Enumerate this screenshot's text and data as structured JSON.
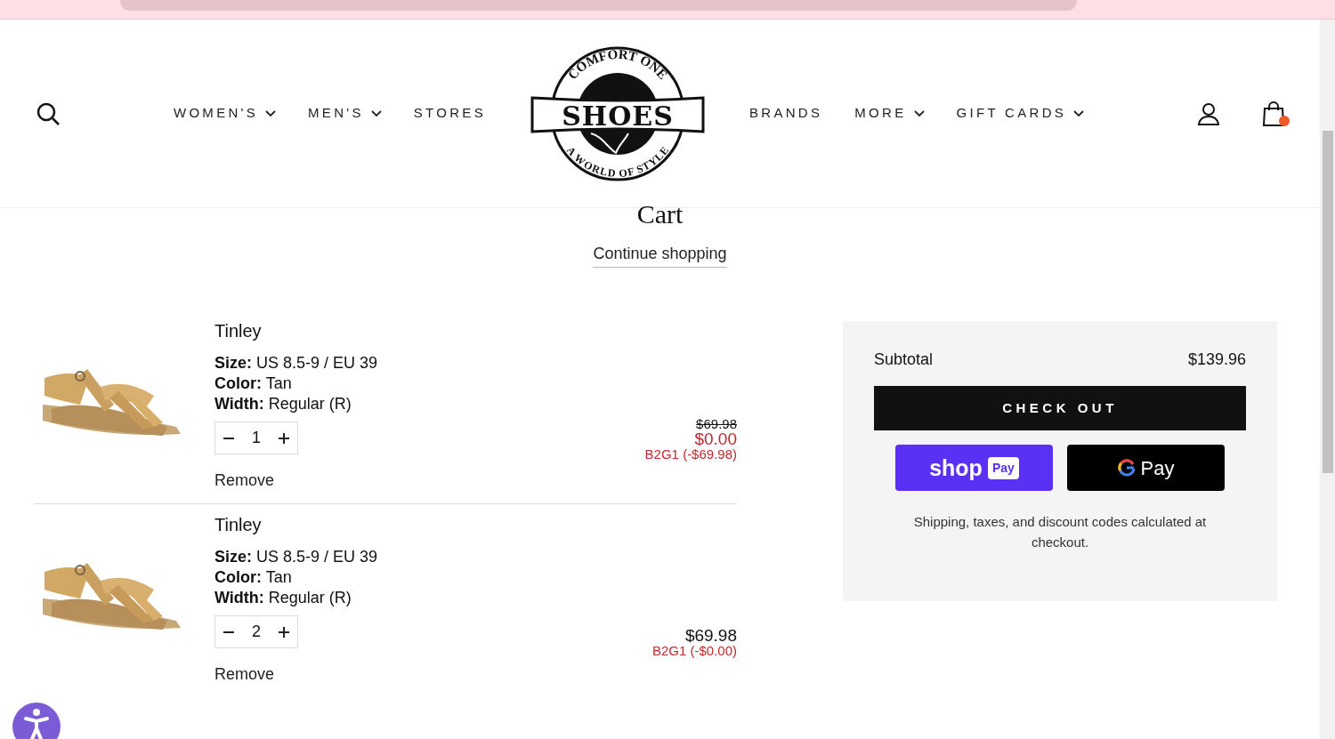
{
  "header": {
    "nav_left": [
      {
        "label": "WOMEN'S",
        "dropdown": true
      },
      {
        "label": "MEN'S",
        "dropdown": true
      },
      {
        "label": "STORES",
        "dropdown": false
      }
    ],
    "logo": {
      "top_text": "COMFORT ONE",
      "main_text": "SHOES",
      "bottom_text": "A WORLD OF STYLE"
    },
    "nav_right": [
      {
        "label": "BRANDS",
        "dropdown": false
      },
      {
        "label": "MORE",
        "dropdown": true
      },
      {
        "label": "GIFT CARDS",
        "dropdown": true
      }
    ],
    "cart_has_items": true
  },
  "cart": {
    "title": "Cart",
    "continue_link": "Continue shopping",
    "items": [
      {
        "name": "Tinley",
        "details": [
          "**Size:** US 8.5-9 / EU 39",
          "**Color:** Tan",
          "**Width:** Regular (R)"
        ],
        "quantity": "1",
        "compare_price": "$69.98",
        "price": "$0.00",
        "discounted": true,
        "discount": "B2G1 (-$69.98)",
        "remove": "Remove"
      },
      {
        "name": "Tinley",
        "details": [
          "**Size:** US 8.5-9 / EU 39",
          "**Color:** Tan",
          "**Width:** Regular (R)"
        ],
        "quantity": "2",
        "price": "$69.98",
        "discounted": false,
        "discount": "B2G1 (-$0.00)",
        "remove": "Remove"
      }
    ]
  },
  "summary": {
    "subtotal_label": "Subtotal",
    "subtotal": "$139.96",
    "checkout": "CHECK OUT",
    "shop_pay": {
      "shop": "shop",
      "pay": "Pay"
    },
    "google_pay": {
      "pay": "Pay"
    },
    "note": "Shipping, taxes, and discount codes calculated at checkout."
  }
}
